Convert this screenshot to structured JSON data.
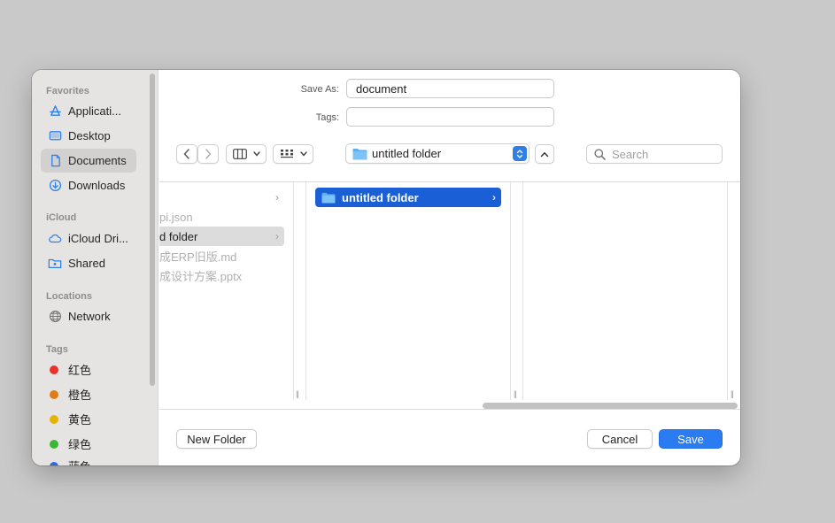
{
  "sidebar": {
    "favorites_title": "Favorites",
    "favorites": [
      {
        "label": "Applicati...",
        "icon": "applications-icon"
      },
      {
        "label": "Desktop",
        "icon": "desktop-icon"
      },
      {
        "label": "Documents",
        "icon": "documents-icon",
        "selected": true
      },
      {
        "label": "Downloads",
        "icon": "downloads-icon"
      }
    ],
    "icloud_title": "iCloud",
    "icloud": [
      {
        "label": "iCloud Dri...",
        "icon": "cloud-icon"
      },
      {
        "label": "Shared",
        "icon": "shared-folder-icon"
      }
    ],
    "locations_title": "Locations",
    "locations": [
      {
        "label": "Network",
        "icon": "globe-icon"
      }
    ],
    "tags_title": "Tags",
    "tags": [
      {
        "label": "红色",
        "color": "#e9322b"
      },
      {
        "label": "橙色",
        "color": "#e07b17"
      },
      {
        "label": "黄色",
        "color": "#e6b400"
      },
      {
        "label": "绿色",
        "color": "#3cb734"
      },
      {
        "label": "蓝色",
        "color": "#2c6be8"
      }
    ]
  },
  "form": {
    "save_as_label": "Save As:",
    "save_as_value": "document",
    "tags_label": "Tags:",
    "tags_value": ""
  },
  "toolbar": {
    "path_folder": "untitled folder",
    "search_placeholder": "Search"
  },
  "browser": {
    "col1": [
      {
        "label": "",
        "chevron": true
      },
      {
        "label": "pi.json"
      },
      {
        "label": "d folder",
        "selected": true,
        "chevron": true
      },
      {
        "label": "成ERP旧版.md"
      },
      {
        "label": "成设计方案.pptx"
      }
    ],
    "col2": [
      {
        "label": "untitled folder",
        "selected": true,
        "chevron": true
      }
    ]
  },
  "footer": {
    "new_folder_label": "New Folder",
    "cancel_label": "Cancel",
    "save_label": "Save"
  },
  "colors": {
    "accent": "#2a7cf0",
    "selection": "#1a5fd6"
  }
}
